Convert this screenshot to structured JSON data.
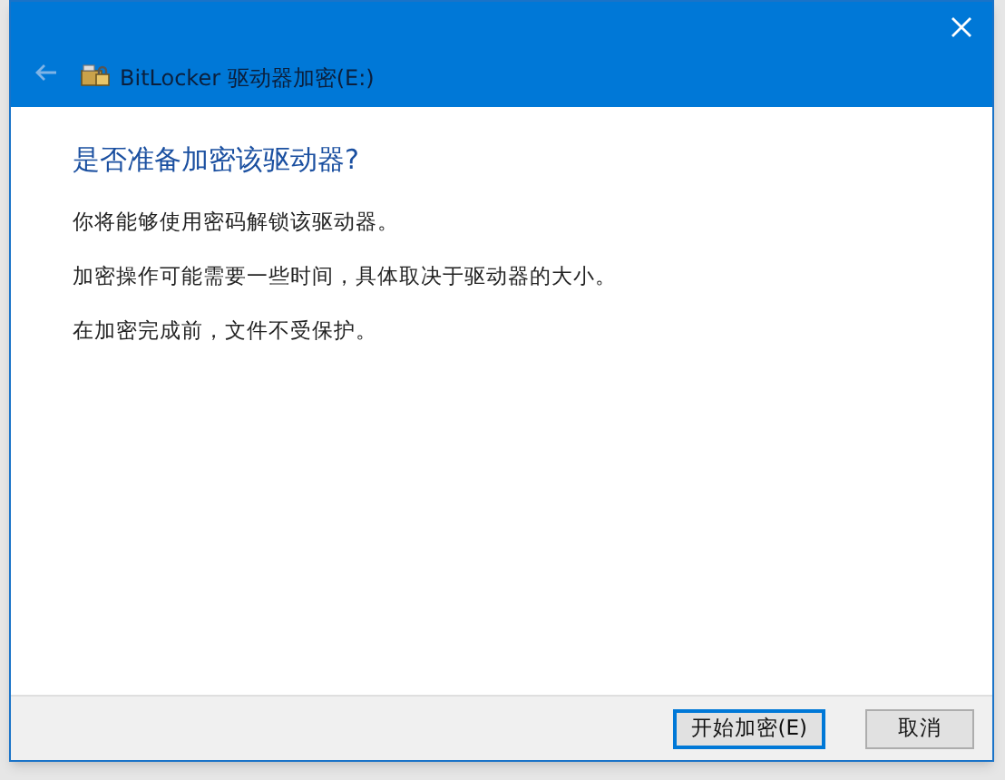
{
  "window": {
    "title": "BitLocker 驱动器加密(E:)",
    "back_button": {
      "disabled": true
    }
  },
  "heading": "是否准备加密该驱动器?",
  "paragraphs": [
    "你将能够使用密码解锁该驱动器。",
    "加密操作可能需要一些时间，具体取决于驱动器的大小。",
    "在加密完成前，文件不受保护。"
  ],
  "buttons": [
    {
      "label": "开始加密(E)",
      "default": true
    },
    {
      "label": "取消",
      "default": false
    }
  ]
}
